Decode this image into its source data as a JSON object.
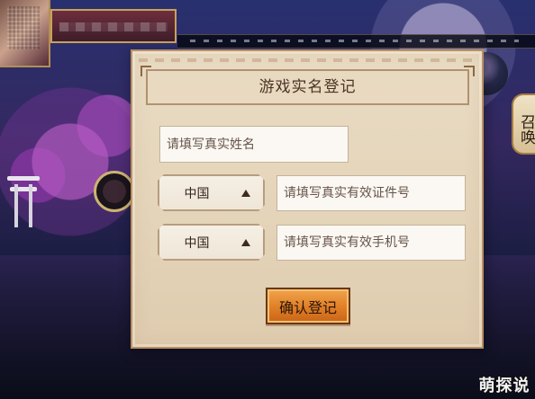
{
  "dialog": {
    "title": "游戏实名登记",
    "name_placeholder": "请填写真实姓名",
    "id_country": "中国",
    "id_placeholder": "请填写真实有效证件号",
    "phone_country": "中国",
    "phone_placeholder": "请填写真实有效手机号",
    "confirm_label": "确认登记"
  },
  "side": {
    "button_label": "召唤"
  },
  "watermark": {
    "label": "萌探说"
  },
  "colors": {
    "dialog_bg": "#e4d4b9",
    "dialog_border": "#b88f63",
    "button_orange": "#df7e25",
    "button_text": "#2a1408"
  },
  "icons": {
    "country_dropdown": "triangle-up-icon"
  }
}
